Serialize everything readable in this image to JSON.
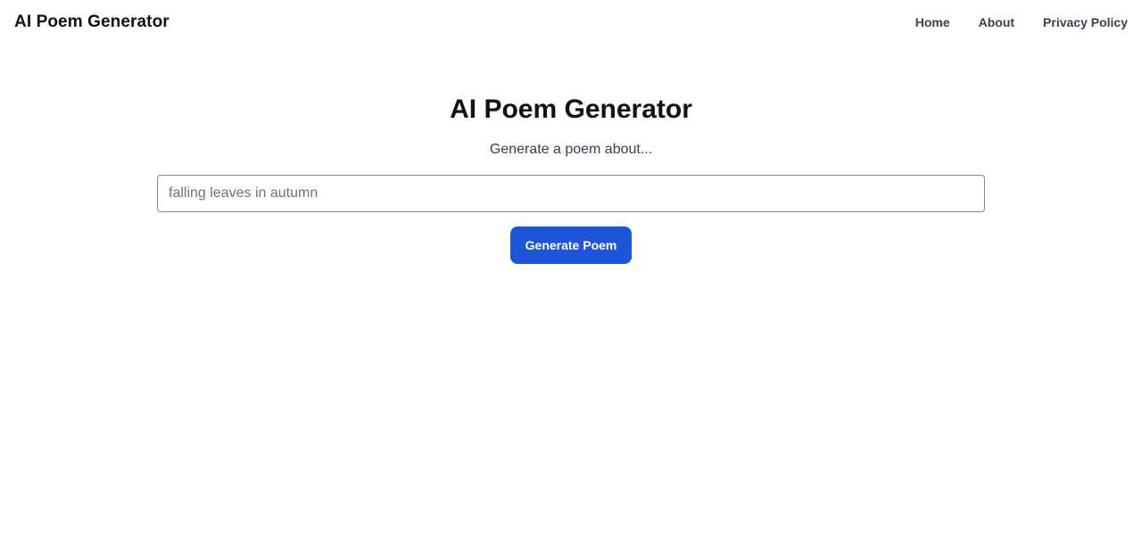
{
  "header": {
    "brand": "AI Poem Generator",
    "nav": [
      {
        "label": "Home"
      },
      {
        "label": "About"
      },
      {
        "label": "Privacy Policy"
      }
    ]
  },
  "main": {
    "title": "AI Poem Generator",
    "subtitle": "Generate a poem about...",
    "input": {
      "value": "",
      "placeholder": "falling leaves in autumn"
    },
    "button_label": "Generate Poem"
  },
  "colors": {
    "accent": "#1d56db",
    "text": "#111111",
    "muted": "#374151"
  }
}
